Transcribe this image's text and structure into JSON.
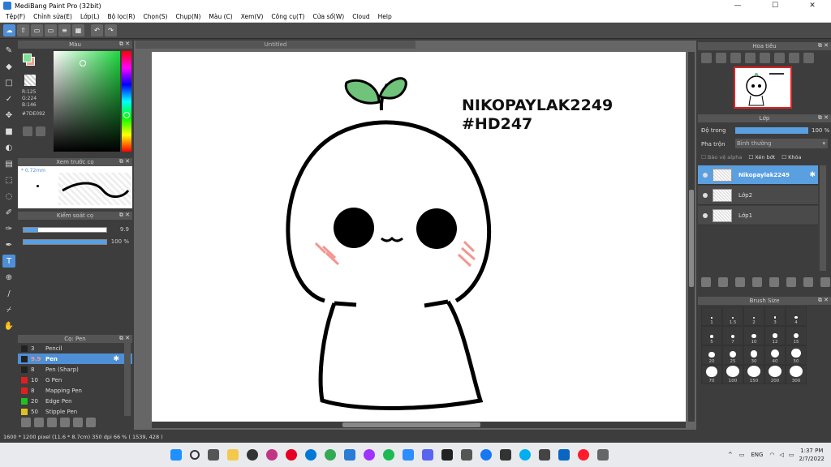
{
  "window": {
    "title": "MediBang Paint Pro (32bit)",
    "minimize": "—",
    "maximize": "☐",
    "close": "✕"
  },
  "menu": [
    "Tệp(F)",
    "Chỉnh sửa(E)",
    "Lớp(L)",
    "Bộ lọc(R)",
    "Chọn(S)",
    "Chụp(N)",
    "Màu (C)",
    "Xem(V)",
    "Công cụ(T)",
    "Cửa sổ(W)",
    "Cloud",
    "Help"
  ],
  "panels": {
    "color": "Màu",
    "preview": "Xem trước cọ",
    "control": "Kiểm soát cọ",
    "brush": "Cọ: Pen",
    "navigator": "Hoa tiêu",
    "layer": "Lớp",
    "brush_size": "Brush Size"
  },
  "color": {
    "r": "R:125",
    "g": "G:224",
    "b": "B:146",
    "hex": "#7DE092"
  },
  "preview": {
    "size": "* 0.72mm"
  },
  "control": {
    "size_value": "9.9",
    "opacity_value": "100 %",
    "size_fraction": 0.18,
    "opacity_fraction": 1.0
  },
  "brushes": [
    {
      "size": "3",
      "name": "Pencil",
      "color": "#222222"
    },
    {
      "size": "9.9",
      "name": "Pen",
      "color": "#222222",
      "selected": true
    },
    {
      "size": "8",
      "name": "Pen (Sharp)",
      "color": "#222222"
    },
    {
      "size": "10",
      "name": "G Pen",
      "color": "#e02020"
    },
    {
      "size": "8",
      "name": "Mapping Pen",
      "color": "#e02020"
    },
    {
      "size": "20",
      "name": "Edge Pen",
      "color": "#20c020"
    },
    {
      "size": "50",
      "name": "Stipple Pen",
      "color": "#e0c020"
    }
  ],
  "canvas": {
    "tab": "Untitled",
    "text_line1": "NIKOPAYLAK2249",
    "text_line2": "#HD247"
  },
  "status": {
    "text": "1600 * 1200 pixel   (11.6 * 8.7cm)   350 dpi   66 %   ( 1539, 428 )"
  },
  "layer": {
    "opacity_label": "Độ trong",
    "opacity_value": "100 %",
    "blend_label": "Pha trộn",
    "blend_value": "Bình thường",
    "protect_alpha": "Bảo vệ alpha",
    "clipping": "Xén bớt",
    "lock": "Khóa",
    "items": [
      {
        "name": "Nikopaylak2249",
        "selected": true
      },
      {
        "name": "Lớp2",
        "selected": false
      },
      {
        "name": "Lớp1",
        "selected": false
      }
    ]
  },
  "brush_sizes": [
    "1",
    "1.5",
    "2",
    "3",
    "4",
    "5",
    "7",
    "10",
    "12",
    "15",
    "20",
    "25",
    "30",
    "40",
    "50",
    "70",
    "100",
    "150",
    "200",
    "300"
  ],
  "taskbar": {
    "lang": "ENG",
    "time": "1:37 PM",
    "date": "2/7/2022"
  }
}
